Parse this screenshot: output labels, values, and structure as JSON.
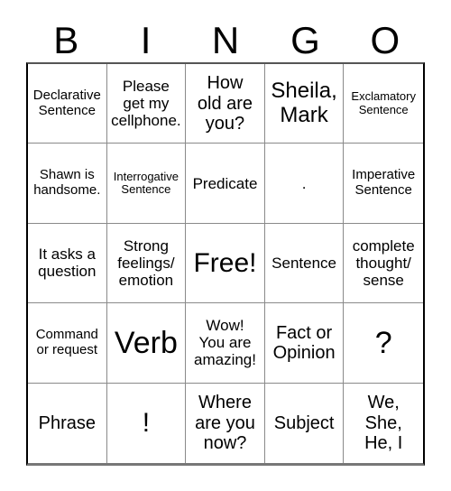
{
  "card": {
    "title": "BINGO",
    "headers": [
      {
        "letter": "B"
      },
      {
        "letter": "I"
      },
      {
        "letter": "N"
      },
      {
        "letter": "G"
      },
      {
        "letter": "O"
      }
    ],
    "rows": [
      [
        {
          "text": "Declarative\nSentence",
          "free": false
        },
        {
          "text": "Please\nget my\ncellphone.",
          "free": false
        },
        {
          "text": "How\nold are\nyou?",
          "free": false
        },
        {
          "text": "Sheila,\nMark",
          "free": false
        },
        {
          "text": "Exclamatory\nSentence",
          "free": false
        }
      ],
      [
        {
          "text": "Shawn is\nhandsome.",
          "free": false
        },
        {
          "text": "Interrogative\nSentence",
          "free": false
        },
        {
          "text": "Predicate",
          "free": false
        },
        {
          "text": ".",
          "free": false
        },
        {
          "text": "Imperative\nSentence",
          "free": false
        }
      ],
      [
        {
          "text": "It asks a\nquestion",
          "free": false
        },
        {
          "text": "Strong\nfeelings/\nemotion",
          "free": false
        },
        {
          "text": "Free!",
          "free": true
        },
        {
          "text": "Sentence",
          "free": false
        },
        {
          "text": "complete\nthought/\nsense",
          "free": false
        }
      ],
      [
        {
          "text": "Command\nor request",
          "free": false
        },
        {
          "text": "Verb",
          "free": false
        },
        {
          "text": "Wow!\nYou are\namazing!",
          "free": false
        },
        {
          "text": "Fact or\nOpinion",
          "free": false
        },
        {
          "text": "?",
          "free": false
        }
      ],
      [
        {
          "text": "Phrase",
          "free": false
        },
        {
          "text": "!",
          "free": false
        },
        {
          "text": "Where\nare you\nnow?",
          "free": false
        },
        {
          "text": "Subject",
          "free": false
        },
        {
          "text": "We,\nShe,\nHe, I",
          "free": false
        }
      ]
    ],
    "colors": {
      "background": "#ffffff",
      "text": "#000000",
      "grid_line": "#8a8a8a",
      "outer_border": "#000000"
    }
  }
}
